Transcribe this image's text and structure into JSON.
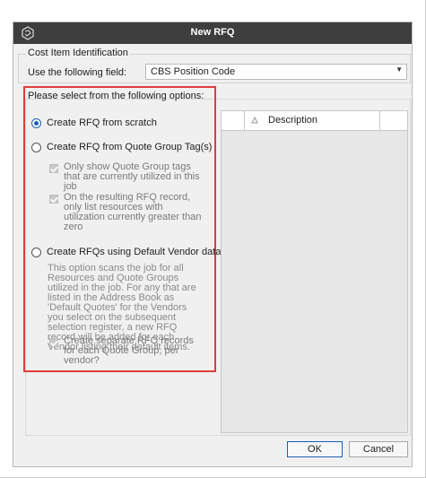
{
  "window": {
    "title": "New RFQ"
  },
  "cost_item": {
    "legend": "Cost Item Identification",
    "field_label": "Use the following field:",
    "field_value": "CBS Position Code"
  },
  "options": {
    "title": "Please select from the following options:",
    "radio_scratch": "Create RFQ from scratch",
    "radio_quote_group": "Create RFQ from Quote Group Tag(s)",
    "check_only_show": "Only show Quote Group tags that are currently utilized in this job",
    "check_only_list": "On the resulting RFQ record, only list resources with utilization currently greater than zero",
    "radio_default_vendor": "Create RFQs using Default Vendor data",
    "default_vendor_description": "This option scans the job for all Resources and Quote Groups utilized in the job. For any that are listed in the Address Book as 'Default Quotes' for the Vendors you select on the subsequent selection register, a new RFQ record will be added for each Vendor listing their default items.",
    "check_separate": "Create separate RFQ records for each Quote Group, per vendor?"
  },
  "table": {
    "column_description": "Description"
  },
  "buttons": {
    "ok": "OK",
    "cancel": "Cancel"
  }
}
